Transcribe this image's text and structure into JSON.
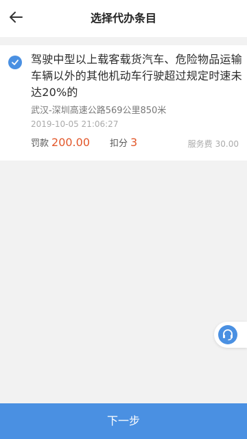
{
  "header": {
    "title": "选择代办条目",
    "back_icon": "arrow-left-icon"
  },
  "item": {
    "selected": true,
    "check_icon": "checkmark-icon",
    "title": "驾驶中型以上载客载货汽车、危险物品运输车辆以外的其他机动车行驶超过规定时速未达20%的",
    "location": "武汉-深圳高速公路569公里850米",
    "time": "2019-10-05 21:06:27",
    "fine_label": "罚款",
    "fine_value": "200.00",
    "points_label": "扣分",
    "points_value": "3",
    "service_label": "服务费",
    "service_value": "30.00"
  },
  "support": {
    "icon": "headset-icon"
  },
  "footer": {
    "next_label": "下一步"
  },
  "colors": {
    "accent": "#4a90e2",
    "highlight": "#e2572a",
    "background": "#f2f2f2"
  }
}
